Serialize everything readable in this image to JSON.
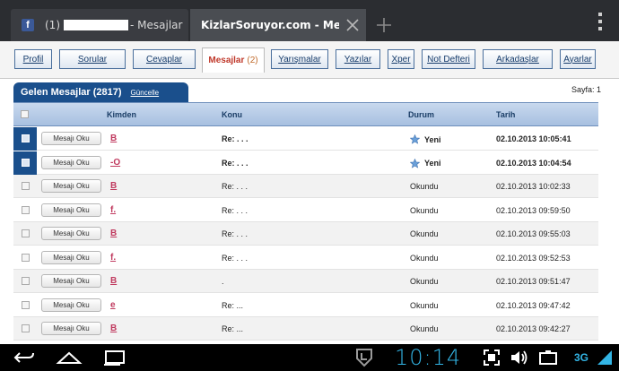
{
  "browser": {
    "tab1": {
      "icon": "f",
      "count": "(1)",
      "title": "- Mesajlar"
    },
    "tab2": {
      "title": "KizlarSoruyor.com - Me..."
    },
    "new_tab": "+"
  },
  "nav": [
    {
      "label": "Profil"
    },
    {
      "label": "Sorular"
    },
    {
      "label": "Cevaplar"
    },
    {
      "label": "Mesajlar",
      "count": "(2)",
      "active": true
    },
    {
      "label": "Yarışmalar"
    },
    {
      "label": "Yazılar"
    },
    {
      "label": "Xper"
    },
    {
      "label": "Not Defteri"
    },
    {
      "label": "Arkadaşlar"
    },
    {
      "label": "Ayarlar"
    }
  ],
  "inbox": {
    "title": "Gelen Mesajlar (2817)",
    "refresh": "Güncelle",
    "page_label": "Sayfa: 1",
    "columns": {
      "from": "Kimden",
      "subject": "Konu",
      "status": "Durum",
      "date": "Tarih"
    },
    "read_button": "Mesajı Oku",
    "rows": [
      {
        "sender": "B",
        "subject": "Re: . . .",
        "status": "Yeni",
        "date": "02.10.2013 10:05:41",
        "unread": true
      },
      {
        "sender": "-O",
        "subject": "Re: . . .",
        "status": "Yeni",
        "date": "02.10.2013 10:04:54",
        "unread": true
      },
      {
        "sender": "B",
        "subject": "Re: . . .",
        "status": "Okundu",
        "date": "02.10.2013 10:02:33",
        "unread": false
      },
      {
        "sender": "f.",
        "subject": "Re: . . .",
        "status": "Okundu",
        "date": "02.10.2013 09:59:50",
        "unread": false
      },
      {
        "sender": "B",
        "subject": "Re: . . .",
        "status": "Okundu",
        "date": "02.10.2013 09:55:03",
        "unread": false
      },
      {
        "sender": "f.",
        "subject": "Re: . . .",
        "status": "Okundu",
        "date": "02.10.2013 09:52:53",
        "unread": false
      },
      {
        "sender": "B",
        "subject": ".",
        "status": "Okundu",
        "date": "02.10.2013 09:51:47",
        "unread": false
      },
      {
        "sender": "e",
        "subject": "Re: ...",
        "status": "Okundu",
        "date": "02.10.2013 09:47:42",
        "unread": false
      },
      {
        "sender": "B",
        "subject": "Re: ...",
        "status": "Okundu",
        "date": "02.10.2013 09:42:27",
        "unread": false
      }
    ]
  },
  "system": {
    "clock": "10:14",
    "network": "3G",
    "accent": "#33b5e5"
  }
}
